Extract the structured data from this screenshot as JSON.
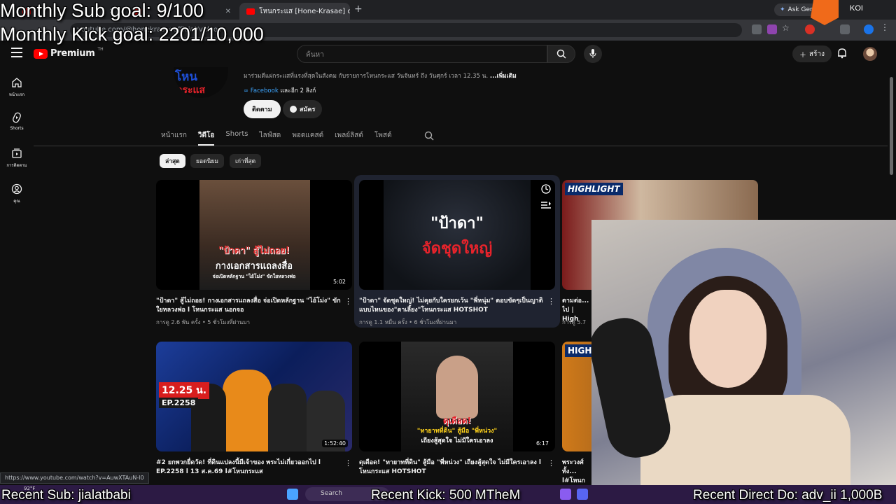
{
  "browser": {
    "tabs": [
      {
        "label": "โหนกระแส [Hone-Krasae] official"
      }
    ],
    "ask_gemini": "Ask Gem",
    "url": "youtube.com/@honekrasaeofficial/videos",
    "status_url": "https://www.youtube.com/watch?v=AuwXTAuN-I0"
  },
  "overlay": {
    "sub_goal": "Monthly Sub goal: 9/100",
    "kick_goal": "Monthly Kick goal: 2201/10,000",
    "recent_sub": "Recent Sub: jialatbabi",
    "recent_kick": "Recent Kick: 500 MTheM",
    "recent_donation": "Recent Direct Do: adv_ii 1,000B",
    "koi_text": "KOI"
  },
  "header": {
    "logo": "Premium",
    "logo_sup": "TH",
    "search_placeholder": "ค้นหา",
    "create_label": "สร้าง"
  },
  "sidebar": [
    {
      "label": "หน้าแรก",
      "icon": "home-icon"
    },
    {
      "label": "Shorts",
      "icon": "shorts-icon"
    },
    {
      "label": "การติดตาม",
      "icon": "subscriptions-icon"
    },
    {
      "label": "คุณ",
      "icon": "you-icon"
    }
  ],
  "channel": {
    "logo_top": "โหน",
    "logo_bottom": "กระแส",
    "description": "มาร่วมตีแผ่กระแสที่แรงที่สุดในสังคม กับรายการโหนกระแส วันจันทร์ ถึง วันศุกร์ เวลา 12.35 น.",
    "more": "...เพิ่มเติม",
    "link": "Facebook",
    "more_links": "และอีก 2 ลิงก์",
    "subscribe": "ติดตาม",
    "join": "สมัคร"
  },
  "tabs": [
    "หน้าแรก",
    "วิดีโอ",
    "Shorts",
    "ไลฟ์สด",
    "พอดแคสต์",
    "เพลย์ลิสต์",
    "โพสต์"
  ],
  "chips": [
    "ล่าสุด",
    "ยอดนิยม",
    "เก่าที่สุด"
  ],
  "videos": [
    {
      "title": "\"ป้าดา\" สู้ไม่ถอย! กางเอกสารแถลงสื่อ จ่อเปิดหลักฐาน \"ไอ้โม่ง\" ขักใยหลวงพ่อ l โหนกระแส นอกจอ",
      "meta": "การดู 2.6 พัน ครั้ง • 5 ชั่วโมงที่ผ่านมา",
      "duration": "5:02",
      "thumb_line1": "\"ป้าดา\" สู้ไม่ถอย!",
      "thumb_line2": "กางเอกสารแถลงสื่อ",
      "thumb_line3": "จ่อเปิดหลักฐาน \"ไอ้โม่ง\" ขักใยหลวงพ่อ"
    },
    {
      "title": "\"ป้าดา\" จัดชุดใหญ่! ไม่คุยกับใครยกเว้น \"พี่หนุ่ม\" ตอบขัดๆเป็นญาติแบบไหนของ\"ตาเลี้ยง\"โหนกระแส HOTSHOT",
      "meta": "การดู 1.1 หมื่น ครั้ง • 6 ชั่วโมงที่ผ่านมา",
      "thumb_line1": "\"ป้าดา\"",
      "thumb_line2": "จัดชุดใหญ่"
    },
    {
      "title": "ตามต่อ... ไป | High",
      "meta": "การดู 5.7",
      "thumb_line1": "HIGHLIGHT"
    },
    {
      "title": "#2 ยกพวกยื่ดวัด! ที่ดินแปลงนี้มีเจ้าของ พระไม่เกี่ยวออกไป l EP.2258 l 13 ส.ค.69 l#โหนกระแส",
      "meta": "",
      "duration": "1:52:40",
      "thumb_line1": "12.25 น.",
      "thumb_line2": "EP.2258"
    },
    {
      "title": "ดุเดือด! \"ทายาทที่ดิน\" สู้มือ \"พี่หน่วง\" เถียงสู้สุดใจ ไม่มีใครเอาลง l โหนกระแส HOTSHOT",
      "meta": "",
      "duration": "6:17",
      "thumb_line1": "ดุเดือด!",
      "thumb_line2": "\"ทายาทที่ดิน\" สู้มือ \"พี่หน่วง\"",
      "thumb_line3": "เถียงสู้สุดใจ ไม่มีใครเอาลง"
    },
    {
      "title": "พระวงศ์ทั้ง... l#โหนกระแส",
      "meta": "",
      "thumb_line1": "HIGHLI"
    }
  ],
  "taskbar": {
    "weather": "92°F",
    "search": "Search"
  }
}
